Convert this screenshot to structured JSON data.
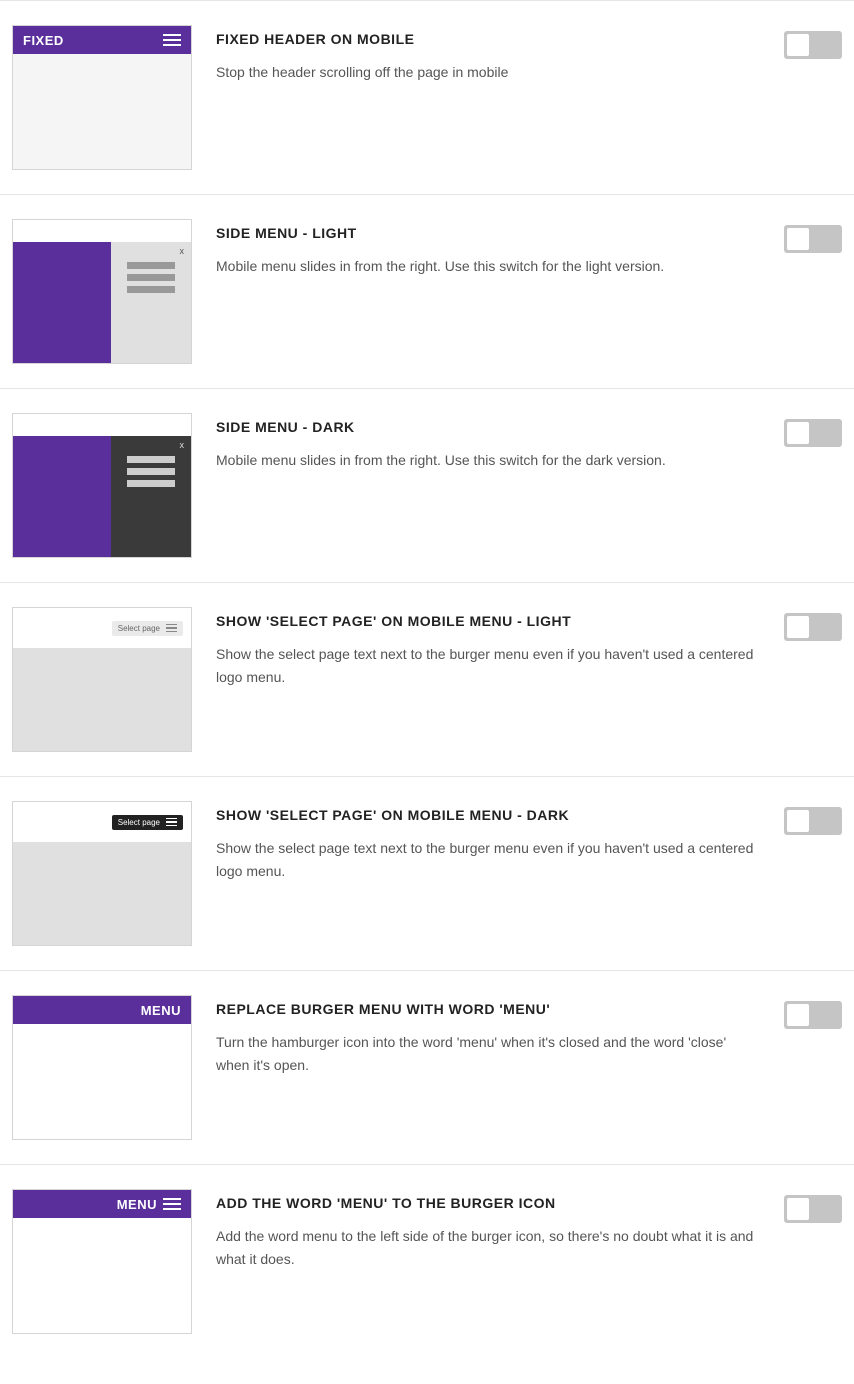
{
  "options": [
    {
      "title": "FIXED HEADER ON MOBILE",
      "desc": "Stop the header scrolling off the page in mobile",
      "thumb_label": "FIXED"
    },
    {
      "title": "SIDE MENU - LIGHT",
      "desc": "Mobile menu slides in from the right. Use this switch for the light version."
    },
    {
      "title": "SIDE MENU - DARK",
      "desc": "Mobile menu slides in from the right. Use this switch for the dark version."
    },
    {
      "title": "SHOW 'SELECT PAGE' ON MOBILE MENU - LIGHT",
      "desc": "Show the select page text next to the burger menu even if you haven't used a centered logo menu.",
      "pill": "Select page"
    },
    {
      "title": "SHOW 'SELECT PAGE' ON MOBILE MENU - DARK",
      "desc": "Show the select page text next to the burger menu even if you haven't used a centered logo menu.",
      "pill": "Select page"
    },
    {
      "title": "REPLACE BURGER MENU WITH WORD 'MENU'",
      "desc": "Turn the hamburger icon into the word 'menu' when it's closed and the word 'close' when it's open.",
      "thumb_label": "MENU"
    },
    {
      "title": "ADD THE WORD 'MENU' TO THE BURGER ICON",
      "desc": "Add the word menu to the left side of the burger icon, so there's no doubt what it is and what it does.",
      "thumb_label": "MENU"
    }
  ]
}
